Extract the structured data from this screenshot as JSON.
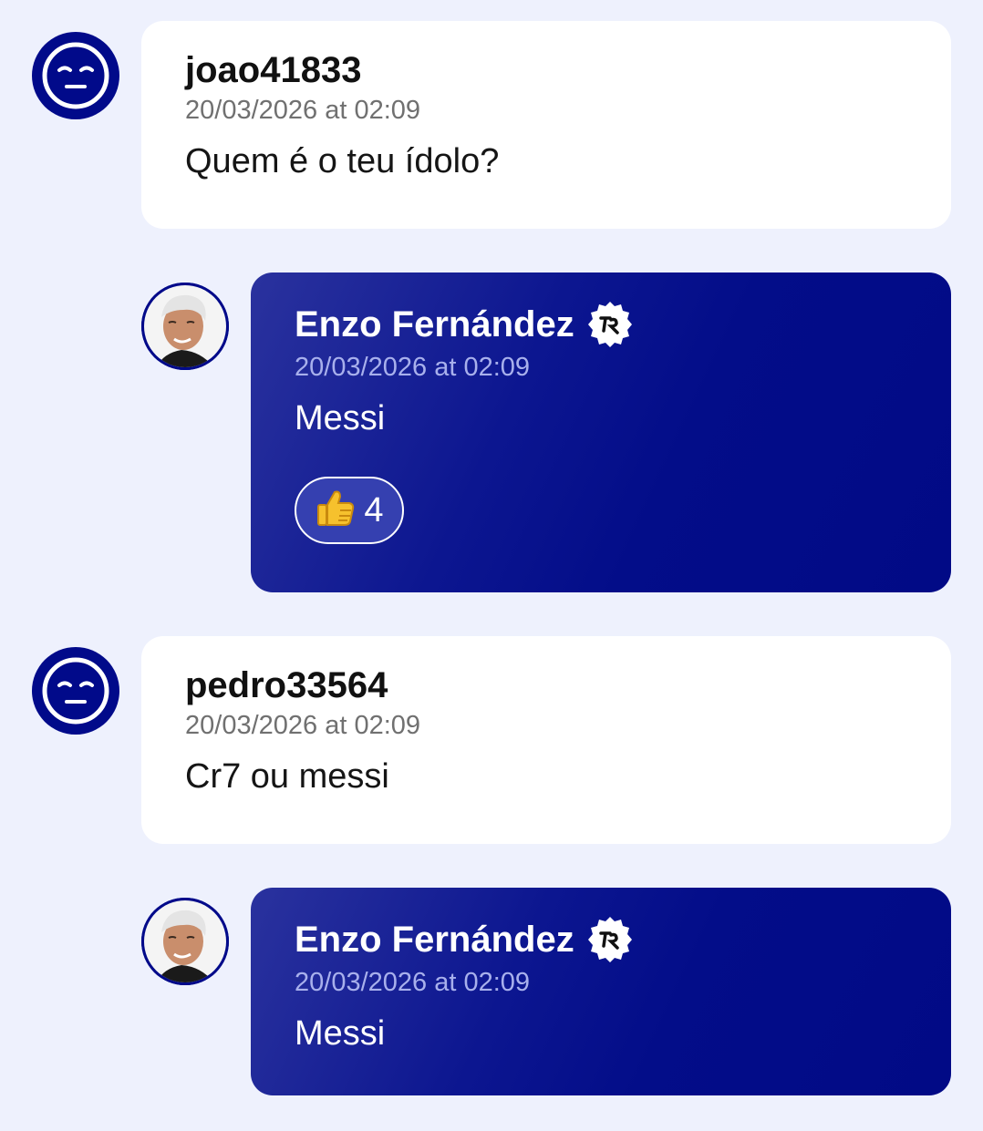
{
  "messages": [
    {
      "author": "joao41833",
      "timestamp": "20/03/2026 at 02:09",
      "text": "Quem é o teu ídolo?",
      "avatar_icon": "neutral-face-icon"
    },
    {
      "author": "Enzo Fernández",
      "timestamp": "20/03/2026 at 02:09",
      "text": "Messi",
      "avatar_icon": "player-photo",
      "verified_icon": "verified-badge-icon",
      "reaction": {
        "emoji": "👍",
        "count": "4"
      }
    },
    {
      "author": "pedro33564",
      "timestamp": "20/03/2026 at 02:09",
      "text": "Cr7 ou messi",
      "avatar_icon": "neutral-face-icon"
    },
    {
      "author": "Enzo Fernández",
      "timestamp": "20/03/2026 at 02:09",
      "text": "Messi",
      "avatar_icon": "player-photo",
      "verified_icon": "verified-badge-icon"
    }
  ],
  "colors": {
    "background": "#eef1fd",
    "accent": "#010a8a",
    "fan_card": "#ffffff"
  }
}
